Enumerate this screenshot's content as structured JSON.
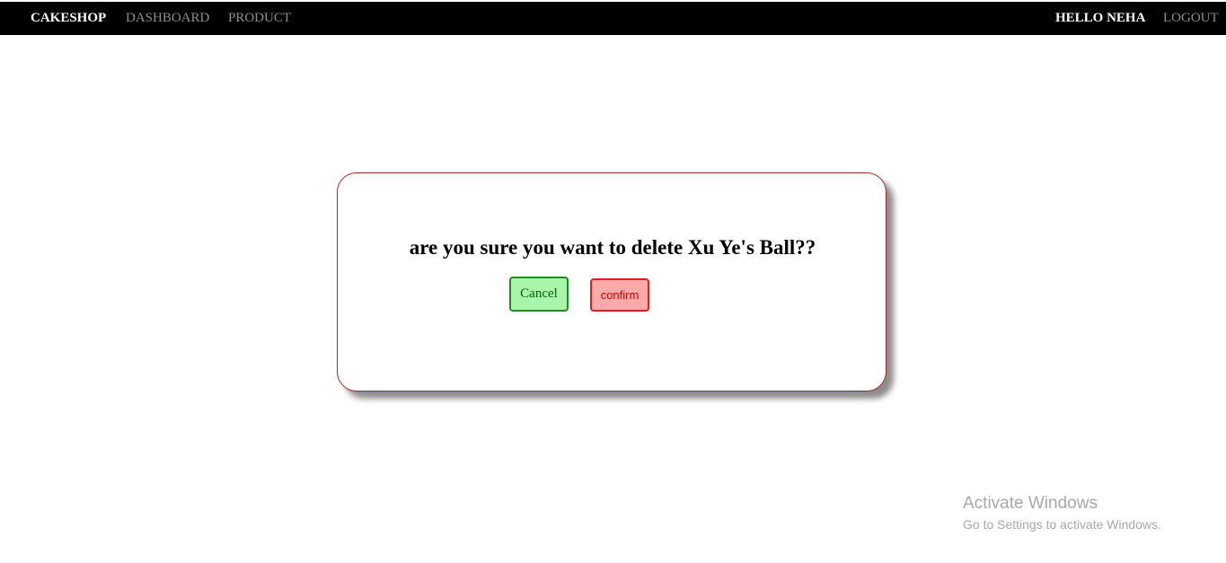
{
  "navbar": {
    "brand": "CAKESHOP",
    "links": [
      "DASHBOARD",
      "PRODUCT"
    ],
    "greeting": "HELLO NEHA",
    "logout": "LOGOUT"
  },
  "dialog": {
    "message": "are you sure you want to delete Xu Ye's Ball??",
    "cancel_label": "Cancel",
    "confirm_label": "confirm"
  },
  "watermark": {
    "title": "Activate Windows",
    "subtitle": "Go to Settings to activate Windows."
  },
  "colors": {
    "navbar_bg": "#000000",
    "dialog_border": "#a52a2a",
    "cancel_bg": "#a9f5a9",
    "confirm_bg": "#ffaaaa"
  }
}
